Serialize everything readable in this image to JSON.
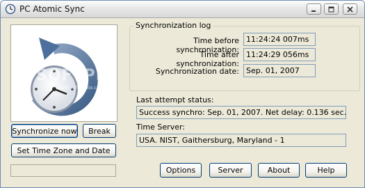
{
  "window": {
    "title": "PC Atomic Sync"
  },
  "logo": {
    "watermark": "SOFTPEDIA",
    "watermark_sub": "www.softpedia.com"
  },
  "buttons": {
    "sync_now": "Synchronize now",
    "brk": "Break",
    "set_tz": "Set Time Zone and Date",
    "options": "Options",
    "server": "Server",
    "about": "About",
    "help": "Help"
  },
  "sync_log": {
    "legend": "Synchronization  log",
    "before_label": "Time before synchronization:",
    "before_value": "11:24:24  007ms",
    "after_label": "Time after synchronization:",
    "after_value": "11:24:29  056ms",
    "date_label": "Synchronization date:",
    "date_value": "Sep. 01, 2007"
  },
  "status": {
    "label": "Last attempt status:",
    "value": "Success synchro: Sep. 01, 2007. Net delay: 0.136 sec."
  },
  "time_server": {
    "label": "Time Server:",
    "value": "USA. NIST, Gaithersburg, Maryland - 1"
  },
  "status_bar": {
    "text": ""
  }
}
